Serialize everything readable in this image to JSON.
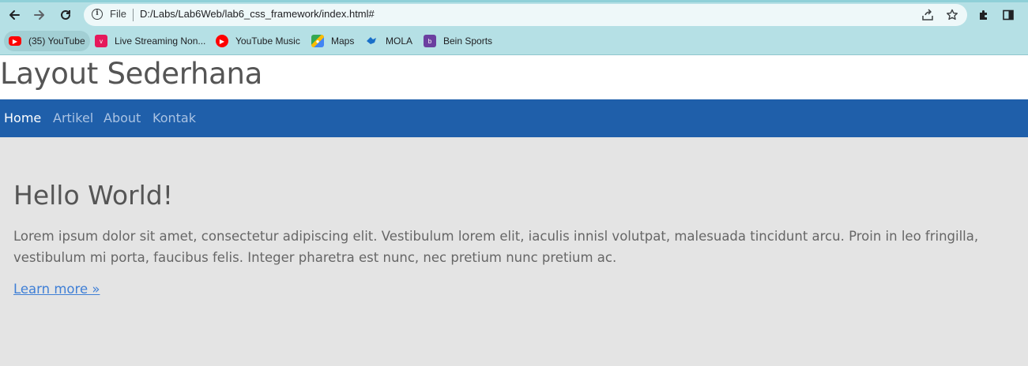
{
  "browser": {
    "back_icon": "arrow-left-icon",
    "forward_icon": "arrow-right-icon",
    "reload_icon": "reload-icon",
    "omnibox": {
      "scheme_label": "File",
      "url": "D:/Labs/Lab6Web/lab6_css_framework/index.html#"
    },
    "bookmarks": [
      {
        "label": "(35) YouTube",
        "icon": "youtube-icon",
        "color": "#ff0000"
      },
      {
        "label": "Live Streaming Non...",
        "icon": "vidio-icon",
        "color": "#e6195c"
      },
      {
        "label": "YouTube Music",
        "icon": "youtube-music-icon",
        "color": "#ff0000"
      },
      {
        "label": "Maps",
        "icon": "maps-icon",
        "color": "#34a853"
      },
      {
        "label": "MOLA",
        "icon": "mola-icon",
        "color": "#1a6fc9"
      },
      {
        "label": "Bein Sports",
        "icon": "bein-sports-icon",
        "color": "#6b3fa0"
      }
    ]
  },
  "page": {
    "header_title": "Layout Sederhana",
    "nav": [
      {
        "label": "Home",
        "active": true
      },
      {
        "label": "Artikel",
        "active": false
      },
      {
        "label": "About",
        "active": false
      },
      {
        "label": "Kontak",
        "active": false
      }
    ],
    "hero": {
      "title": "Hello World!",
      "text": "Lorem ipsum dolor sit amet, consectetur adipiscing elit. Vestibulum lorem elit, iaculis innisl volutpat, malesuada tincidunt arcu. Proin in leo fringilla, vestibulum mi porta, faucibus felis. Integer pharetra est nunc, nec pretium nunc pretium ac.",
      "link": "Learn more »"
    }
  },
  "colors": {
    "chrome": "#b5e0e5",
    "navbar": "#1f5faa",
    "content_bg": "#e4e4e4",
    "link": "#3f7fd6"
  }
}
